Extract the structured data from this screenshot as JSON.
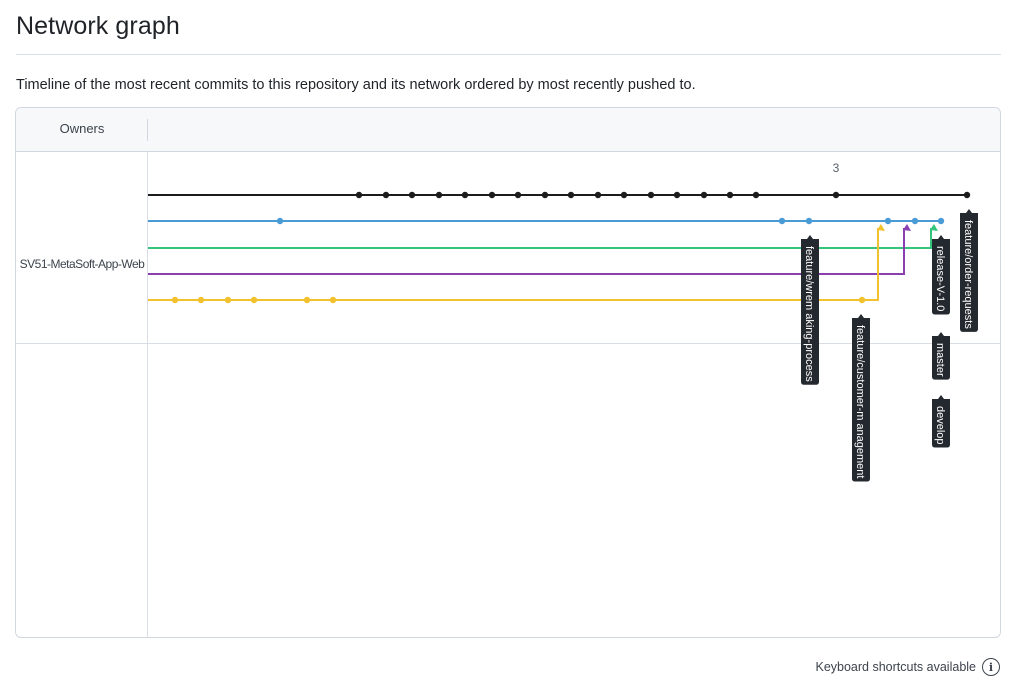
{
  "page": {
    "title": "Network graph",
    "description": "Timeline of the most recent commits to this repository and its network ordered by most recently pushed to."
  },
  "graph": {
    "owners_header": "Owners",
    "owner_name": "SV51-MetaSoft-App-Web",
    "date_tick": "3",
    "colors": {
      "black": "#1c1c1c",
      "blue": "#4a9bd5",
      "green": "#34c47c",
      "purple": "#8a3fb0",
      "yellow": "#f2c12e",
      "label_bg": "#24292f"
    },
    "branch_labels": [
      {
        "text": "feature/order-requests"
      },
      {
        "text": "release-V-1.0"
      },
      {
        "text": "master"
      },
      {
        "text": "develop"
      },
      {
        "text": "feature/wrem aking-process"
      },
      {
        "text": "feature/customer-m anagement"
      }
    ]
  },
  "footer": {
    "shortcuts_label": "Keyboard shortcuts available",
    "info_icon": "info-icon"
  }
}
